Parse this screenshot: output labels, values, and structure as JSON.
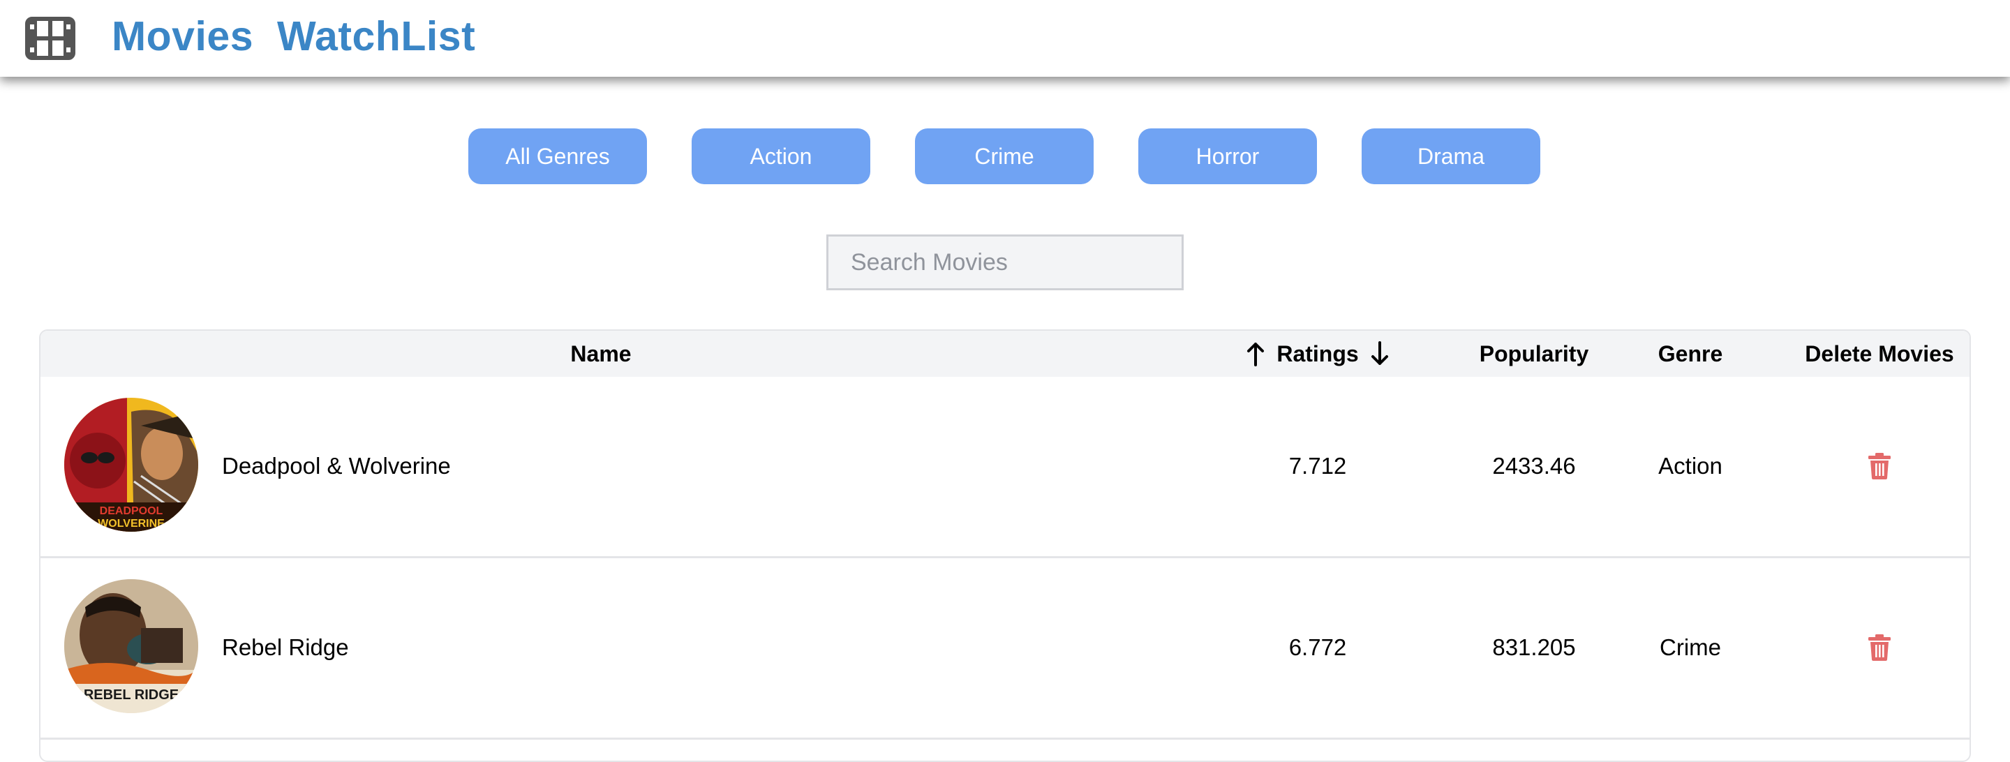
{
  "header": {
    "icon": "film-icon",
    "title_word1": "Movies",
    "title_word2": "WatchList",
    "brand_color": "#3b86c6"
  },
  "genres": {
    "button_color": "#70a3f3",
    "items": [
      "All Genres",
      "Action",
      "Crime",
      "Horror",
      "Drama"
    ]
  },
  "search": {
    "placeholder": "Search Movies",
    "value": ""
  },
  "table": {
    "columns": {
      "name": "Name",
      "ratings": "Ratings",
      "popularity": "Popularity",
      "genre": "Genre",
      "delete": "Delete Movies"
    },
    "sort_icons": [
      "arrow-up-icon",
      "arrow-down-icon"
    ],
    "rows": [
      {
        "poster_text": "DEADPOOL & WOLVERINE",
        "name": "Deadpool & Wolverine",
        "rating": "7.712",
        "popularity": "2433.46",
        "genre": "Action",
        "delete_icon": "trash-icon"
      },
      {
        "poster_text": "REBEL RIDGE",
        "name": "Rebel Ridge",
        "rating": "6.772",
        "popularity": "831.205",
        "genre": "Crime",
        "delete_icon": "trash-icon"
      }
    ],
    "delete_color": "#e36a6a"
  }
}
